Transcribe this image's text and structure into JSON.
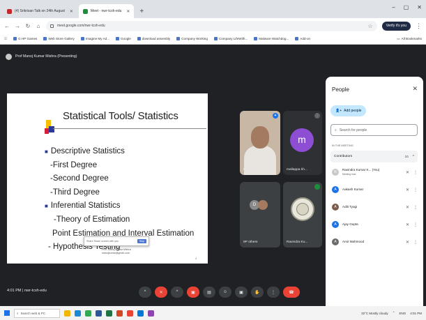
{
  "browser": {
    "tabs": [
      {
        "label": "(4) Srikrisan Talk on 24th August",
        "fav_color": "#c62828"
      },
      {
        "label": "Meet - nwr-tcsh-edu",
        "fav_color": "#1e8e3e"
      }
    ],
    "new_tab": "+",
    "window_controls": {
      "minimize": "–",
      "maximize": "▢",
      "close": "✕"
    },
    "url": "meet.google.com/nwr-tcsh-edu",
    "profile": "Verify it's you",
    "bookmarks": [
      "G HP Games",
      "Web Store Gallery",
      "Imagine My Ad...",
      "Google",
      "download assembly",
      "Company Working",
      "Company LifeWith...",
      "Malware Watchdog...",
      "Add-on"
    ],
    "all_bookmarks": "All Bookmarks"
  },
  "meet": {
    "presenter_label": "Prof Manoj Kumar Mishra (Presenting)",
    "slide": {
      "title": "Statistical Tools/ Statistics",
      "lines": [
        "Descriptive Statistics",
        "-First Degree",
        "-Second Degree",
        "-Third Degree",
        "Inferential Statistics",
        "-Theory of Estimation",
        "Point Estimation and Interval Estimation",
        "- Hypothesis Testing"
      ],
      "tooltip_text": "Share Share screen with you",
      "tooltip_button": "Stop",
      "email_name": "Prof. Manoj Kumar Mishra",
      "email": "manojkumar@gmail.com",
      "page_number": "4"
    },
    "tiles": [
      {
        "name": "Prof Manoj Ku..."
      },
      {
        "name": "mallappa kh...",
        "initial": "m"
      },
      {
        "name": "9P others",
        "initial": "D"
      },
      {
        "name": "Ravindra Ku..."
      }
    ],
    "clock": "4:01 PM  |  nwr-tcsh-edu",
    "controls": [
      "^",
      "mic-off",
      "^",
      "cam-off",
      "cc",
      "emoji",
      "present",
      "hand",
      "more",
      "end-call"
    ]
  },
  "people_panel": {
    "title": "People",
    "add_people": "Add people",
    "search_placeholder": "Search for people",
    "section": "IN THE MEETING",
    "contributors": "Contributors",
    "contributors_count": "10",
    "people": [
      {
        "name": "Ravindra Kumar K... (You)",
        "sub": "Meeting host",
        "initial": "R",
        "color": "#c8c8c8"
      },
      {
        "name": "Aakash Kumar",
        "sub": "",
        "initial": "A",
        "color": "#1a73e8"
      },
      {
        "name": "Aditi Tyagi",
        "sub": "",
        "initial": "A",
        "color": "#7b5c4a"
      },
      {
        "name": "Ajay Gupta",
        "sub": "",
        "initial": "A",
        "color": "#1a73e8"
      },
      {
        "name": "Amir Mahmood",
        "sub": "",
        "initial": "A",
        "color": "#6b6b6b"
      }
    ]
  },
  "taskbar": {
    "search": "Search web & PC",
    "weather": "32°C Mostly cloudy",
    "lang": "ENG",
    "time": "4:01 PM"
  }
}
